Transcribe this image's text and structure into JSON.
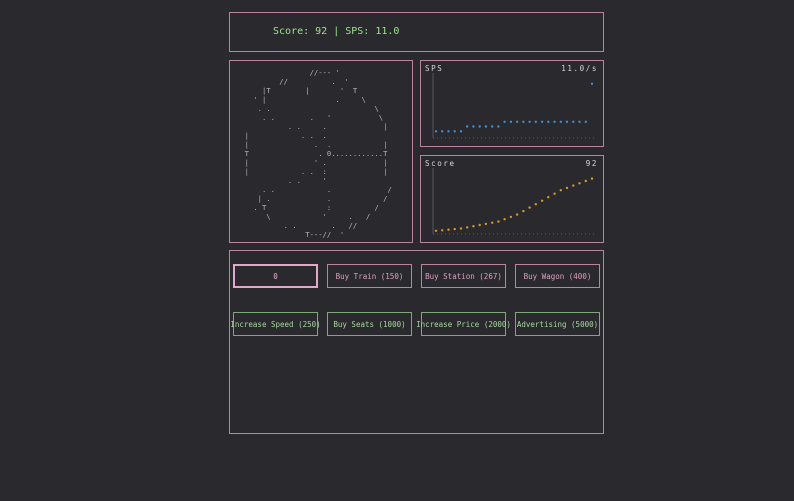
{
  "header": {
    "text": "Score: 92 | SPS: 11.0"
  },
  "wheel": {
    "art": [
      "                 //--- '",
      "          //          .  '",
      "      |T        |       '  T",
      "    ' |                .     \\",
      "     . .                        \\",
      "      . .        .   '           \\",
      "            . .     .             |",
      "  |            . .  .",
      "  |               .  .            |",
      "  T                . 0............T",
      "  |               ' .             |",
      "  |            . .  :             |",
      "            . .     '",
      "      . .            .             /",
      "     | .             .            /",
      "    . T              :          /",
      "       \\            '     .   /",
      "           . .        .   //",
      "                T---//  '"
    ]
  },
  "sps_chart": {
    "label": "SPS",
    "value_text": "11.0/s",
    "color": "#3f8fd2",
    "chart_data": {
      "type": "scatter",
      "x": [
        0,
        1,
        2,
        3,
        4,
        5,
        6,
        7,
        8,
        9,
        10,
        11,
        12,
        13,
        14,
        15,
        16,
        17,
        18,
        19,
        20,
        21,
        22,
        23,
        24,
        25
      ],
      "y": [
        1,
        1,
        1,
        1,
        1,
        2,
        2,
        2,
        2,
        2,
        2,
        3,
        3,
        3,
        3,
        3,
        3,
        3,
        3,
        3,
        3,
        3,
        3,
        3,
        3,
        11
      ],
      "ylim": [
        0,
        12
      ]
    }
  },
  "score_chart": {
    "label": "Score",
    "value_text": "92",
    "color": "#d49a2a",
    "chart_data": {
      "type": "scatter",
      "x": [
        0,
        1,
        2,
        3,
        4,
        5,
        6,
        7,
        8,
        9,
        10,
        11,
        12,
        13,
        14,
        15,
        16,
        17,
        18,
        19,
        20,
        21,
        22,
        23,
        24,
        25
      ],
      "y": [
        2,
        3,
        4,
        5,
        6,
        8,
        10,
        12,
        14,
        16,
        18,
        22,
        26,
        30,
        36,
        42,
        48,
        54,
        60,
        66,
        72,
        76,
        80,
        84,
        88,
        92
      ],
      "ylim": [
        0,
        100
      ]
    }
  },
  "buttons": [
    {
      "label": "0",
      "style": "pink",
      "active": true
    },
    {
      "label": "Buy Train (150)",
      "style": "pink"
    },
    {
      "label": "Buy Station (267)",
      "style": "pink"
    },
    {
      "label": "Buy Wagon (400)",
      "style": "pink"
    },
    {
      "label": "Increase Speed (250)",
      "style": "green"
    },
    {
      "label": "Buy Seats (1000)",
      "style": "green"
    },
    {
      "label": "Increase Price (2000)",
      "style": "green"
    },
    {
      "label": "Advertising (5000)",
      "style": "green"
    }
  ]
}
